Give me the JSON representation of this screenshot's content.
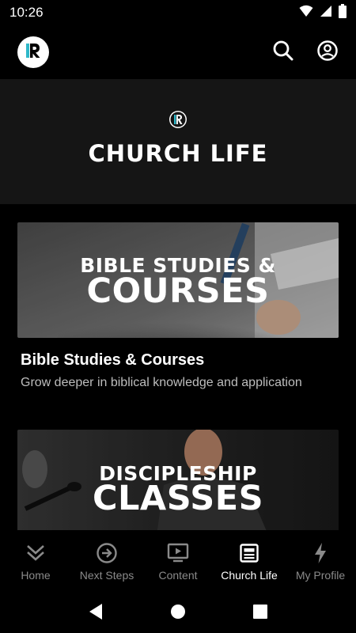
{
  "status_bar": {
    "time": "10:26",
    "icons": [
      "wifi-icon",
      "signal-icon",
      "battery-icon"
    ]
  },
  "app_bar": {
    "logo_icon": "r-logo-icon",
    "actions": [
      "search-icon",
      "account-circle-icon"
    ]
  },
  "header": {
    "title": "CHURCH LIFE",
    "logo_icon": "r-logo-icon"
  },
  "cards": [
    {
      "image_text_line1": "BIBLE STUDIES &",
      "image_text_line2": "COURSES",
      "title": "Bible Studies & Courses",
      "subtitle": "Grow deeper in biblical knowledge and application"
    },
    {
      "image_text_line1": "DISCIPLESHIP",
      "image_text_line2": "CLASSES",
      "title": "",
      "subtitle": ""
    }
  ],
  "bottom_nav": {
    "items": [
      {
        "label": "Home",
        "icon": "double-chevron-down-icon",
        "active": false
      },
      {
        "label": "Next Steps",
        "icon": "arrow-circle-right-icon",
        "active": false
      },
      {
        "label": "Content",
        "icon": "tv-play-icon",
        "active": false
      },
      {
        "label": "Church Life",
        "icon": "newspaper-icon",
        "active": true
      },
      {
        "label": "My Profile",
        "icon": "lightning-bolt-icon",
        "active": false
      }
    ]
  },
  "colors": {
    "background": "#000000",
    "header_bg": "#151515",
    "active": "#ffffff",
    "inactive": "#8a8a8a",
    "subtitle": "#bdbdbd",
    "logo_accent": "#2fb8c9"
  }
}
